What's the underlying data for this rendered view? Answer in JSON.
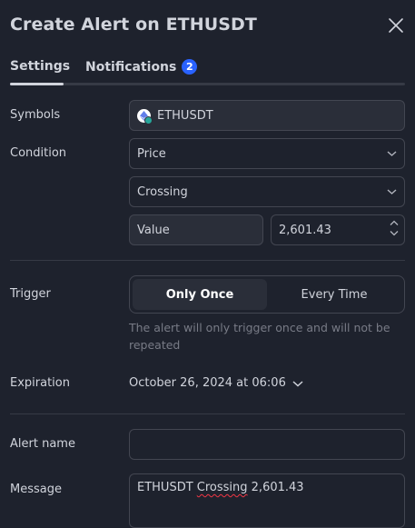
{
  "dialog": {
    "title": "Create Alert on ETHUSDT",
    "close_icon": "close-icon"
  },
  "tabs": {
    "settings": "Settings",
    "notifications": "Notifications",
    "notifications_badge": "2"
  },
  "symbols": {
    "label": "Symbols",
    "value": "ETHUSDT",
    "icon": "ethereum-icon"
  },
  "condition": {
    "label": "Condition",
    "source": "Price",
    "operator": "Crossing",
    "value_type": "Value",
    "value": "2,601.43"
  },
  "trigger": {
    "label": "Trigger",
    "options": [
      "Only Once",
      "Every Time"
    ],
    "selected": "Only Once",
    "hint": "The alert will only trigger once and will not be repeated"
  },
  "expiration": {
    "label": "Expiration",
    "value": "October 26, 2024 at 06:06"
  },
  "alert_name": {
    "label": "Alert name",
    "value": ""
  },
  "message": {
    "label": "Message",
    "prefix": "ETHUSDT ",
    "misspelled": "Crossing",
    "suffix": " 2,601.43"
  },
  "colors": {
    "background": "#1e222d",
    "accent": "#2962ff",
    "text": "#d1d4dc",
    "muted": "#787b86"
  }
}
